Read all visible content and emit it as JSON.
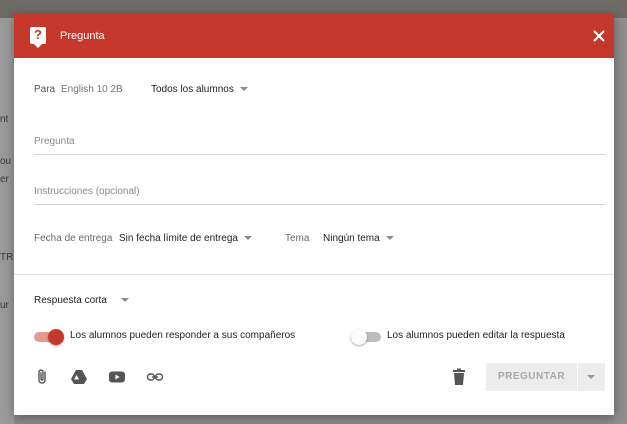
{
  "background": {
    "side_fragments": [
      "nt",
      "ou",
      "er",
      "TR",
      "ur"
    ]
  },
  "dialog": {
    "header": {
      "title": "Pregunta",
      "icon": "question-icon",
      "close_icon": "close-icon",
      "accent_color": "#c5372a"
    },
    "recipients": {
      "label": "Para",
      "class_name": "English 10 2B",
      "students_value": "Todos los alumnos"
    },
    "question_field": {
      "placeholder": "Pregunta"
    },
    "instructions_field": {
      "placeholder": "Instrucciones (opcional)"
    },
    "due": {
      "label": "Fecha de entrega",
      "value": "Sin fecha límite de entrega"
    },
    "topic": {
      "label": "Tema",
      "value": "Ningún tema"
    },
    "answer_type": {
      "value": "Respuesta corta"
    },
    "toggles": [
      {
        "label": "Los alumnos pueden responder a sus compañeros",
        "on": true
      },
      {
        "label": "Los alumnos pueden editar la respuesta",
        "on": false
      }
    ],
    "attach_icons": [
      "attach-icon",
      "drive-icon",
      "youtube-icon",
      "link-icon"
    ],
    "delete_icon": "trash-icon",
    "ask_button": {
      "label": "PREGUNTAR",
      "enabled": false
    }
  }
}
